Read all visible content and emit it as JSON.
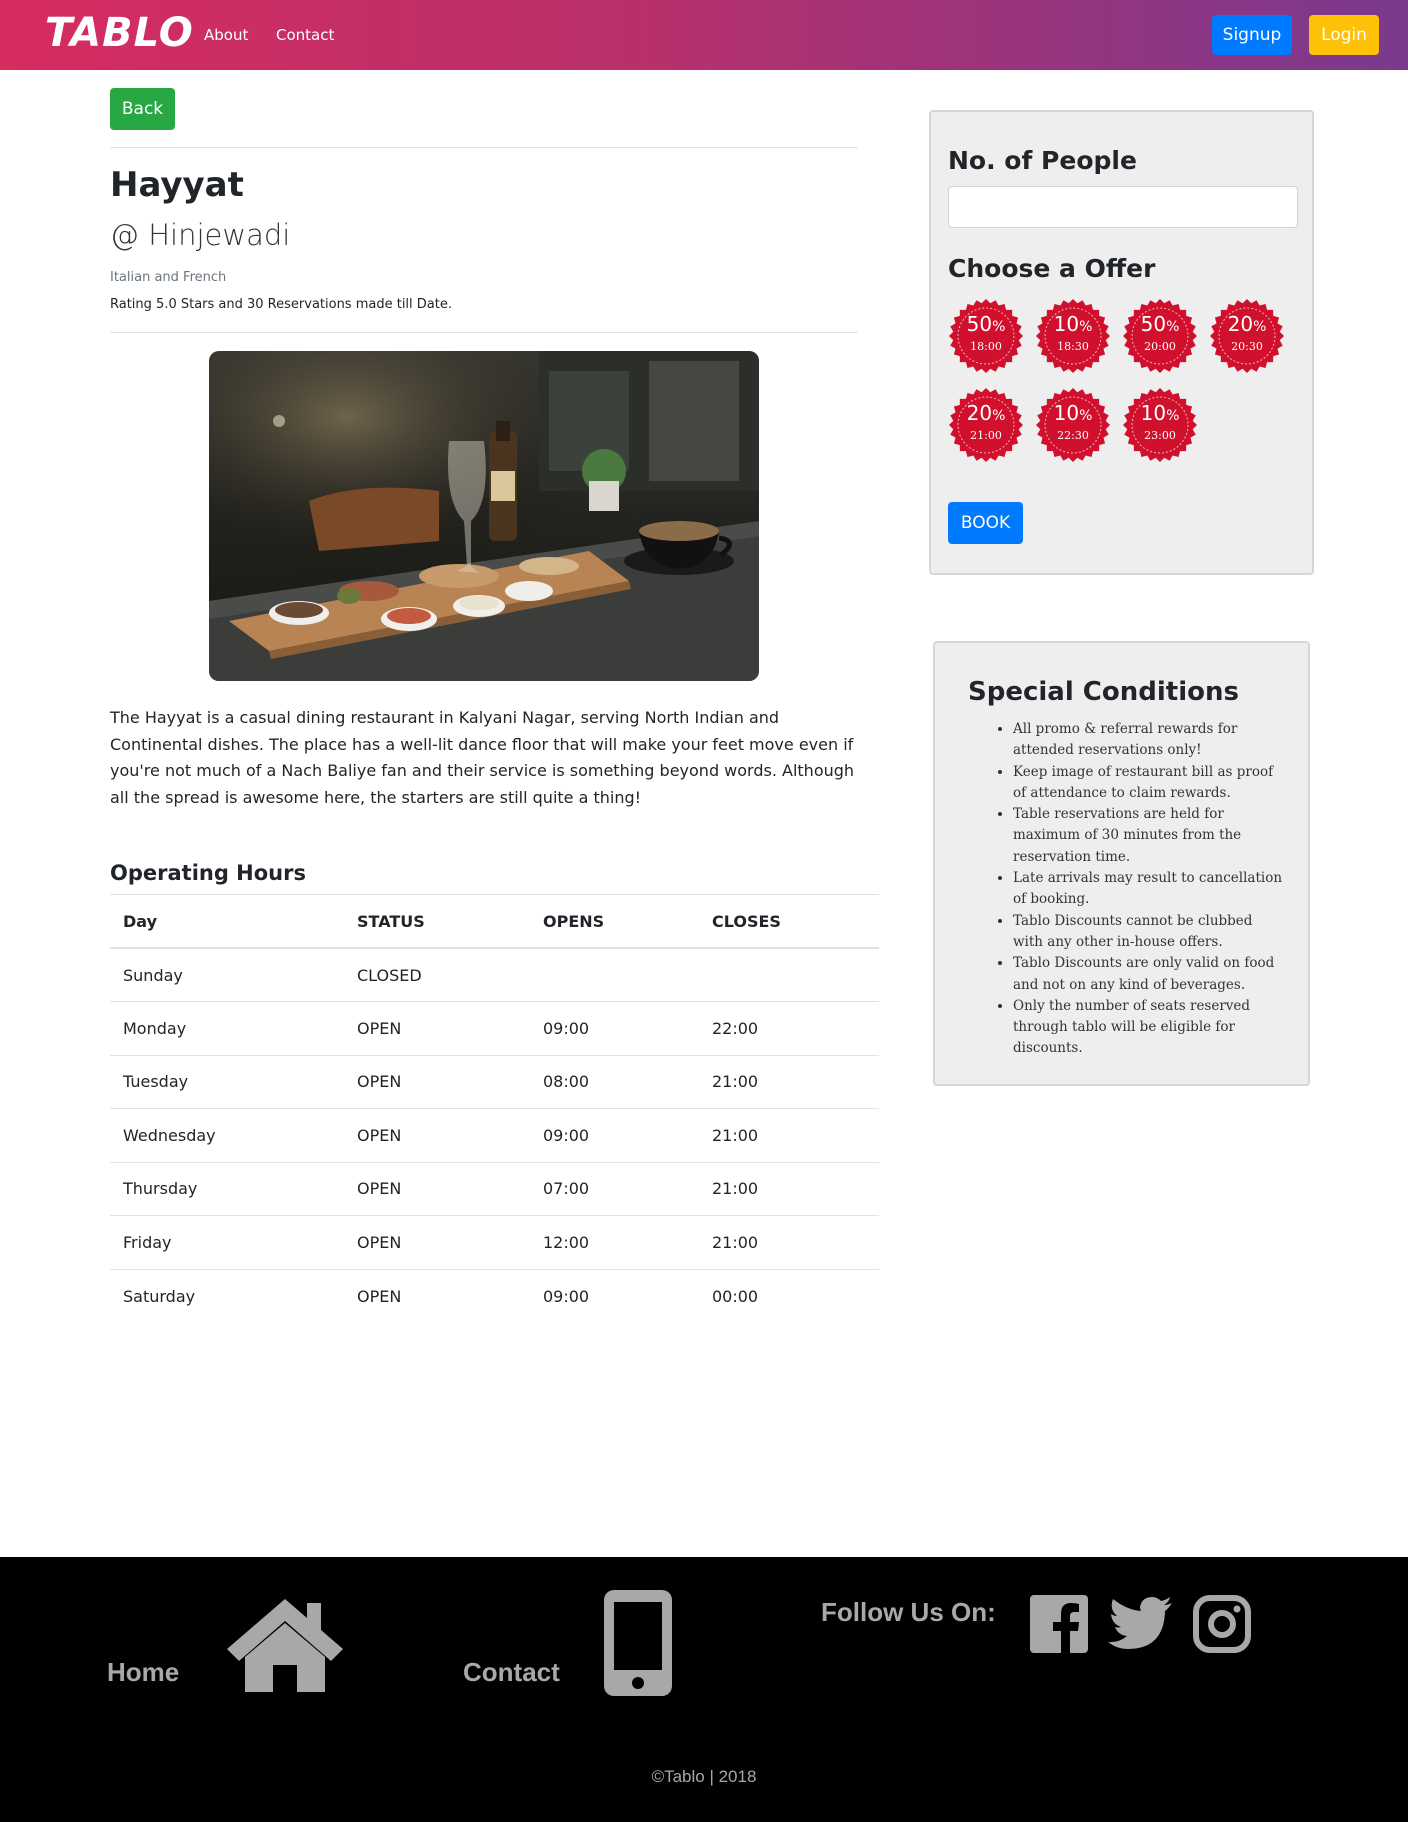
{
  "navbar": {
    "brand": "TABLO",
    "links": [
      "About",
      "Contact"
    ],
    "signup_label": "Signup",
    "login_label": "Login",
    "gradient_colors": [
      "#d62c60",
      "#7a3a8c"
    ]
  },
  "back_label": "Back",
  "restaurant": {
    "name": "Hayyat",
    "location": "@ Hinjewadi",
    "cuisine": "Italian and French",
    "rating_text": "Rating 5.0 Stars and 30 Reservations made till Date.",
    "photo_subject": "restaurant-table-food-photo",
    "description": "The Hayyat is a casual dining restaurant in Kalyani Nagar, serving North Indian and Continental dishes. The place has a well-lit dance floor that will make your feet move even if you're not much of a Nach Baliye fan and their service is something beyond words. Although all the spread is awesome here, the starters are still quite a thing!"
  },
  "hours": {
    "title": "Operating Hours",
    "headers": [
      "Day",
      "STATUS",
      "OPENS",
      "CLOSES"
    ],
    "rows": [
      [
        "Sunday",
        "CLOSED",
        "",
        ""
      ],
      [
        "Monday",
        "OPEN",
        "09:00",
        "22:00"
      ],
      [
        "Tuesday",
        "OPEN",
        "08:00",
        "21:00"
      ],
      [
        "Wednesday",
        "OPEN",
        "09:00",
        "21:00"
      ],
      [
        "Thursday",
        "OPEN",
        "07:00",
        "21:00"
      ],
      [
        "Friday",
        "OPEN",
        "12:00",
        "21:00"
      ],
      [
        "Saturday",
        "OPEN",
        "09:00",
        "00:00"
      ]
    ]
  },
  "booking": {
    "people_label": "No. of People",
    "people_value": "",
    "offer_label": "Choose a Offer",
    "offers": [
      {
        "pct": "50",
        "time": "18:00"
      },
      {
        "pct": "10",
        "time": "18:30"
      },
      {
        "pct": "50",
        "time": "20:00"
      },
      {
        "pct": "20",
        "time": "20:30"
      },
      {
        "pct": "20",
        "time": "21:00"
      },
      {
        "pct": "10",
        "time": "22:30"
      },
      {
        "pct": "10",
        "time": "23:00"
      }
    ],
    "offer_color": "#d0102d",
    "book_label": "BOOK"
  },
  "conditions": {
    "title": "Special Conditions",
    "items": [
      "All promo & referral rewards for attended reservations only!",
      "Keep image of restaurant bill as proof of attendance to claim rewards.",
      "Table reservations are held for maximum of 30 minutes from the reservation time.",
      "Late arrivals may result to cancellation of booking.",
      "Tablo Discounts cannot be clubbed with any other in-house offers.",
      "Tablo Discounts are only valid on food and not on any kind of beverages.",
      "Only the number of seats reserved through tablo will be eligible for discounts."
    ]
  },
  "footer": {
    "home_label": "Home",
    "contact_label": "Contact",
    "follow_label": "Follow Us On:",
    "icons": [
      "home-icon",
      "mobile-phone-icon",
      "facebook-icon",
      "twitter-icon",
      "instagram-icon"
    ],
    "copyright": "©Tablo | 2018"
  },
  "colors": {
    "primary": "#007bff",
    "success": "#28a745",
    "warning": "#ffc107",
    "footer_bg": "#000000",
    "footer_text": "#a8a8a8"
  }
}
